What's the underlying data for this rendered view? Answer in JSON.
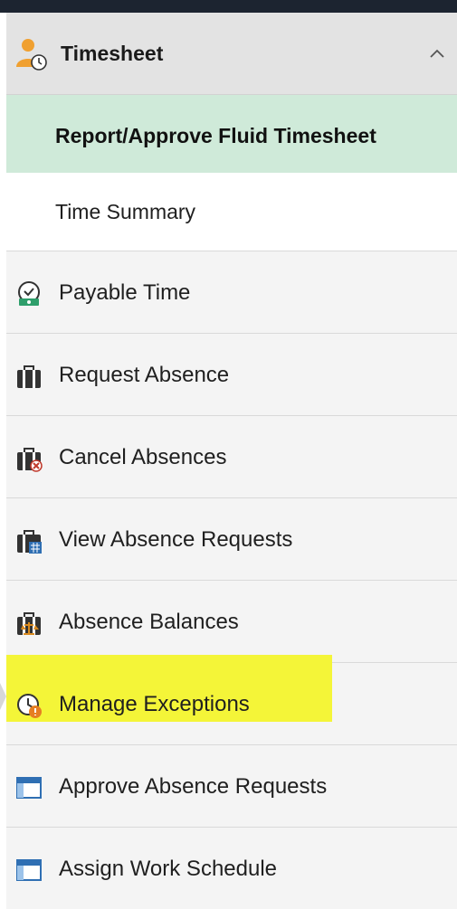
{
  "menu": {
    "header": {
      "title": "Timesheet",
      "icon": "user-clock-icon",
      "chevron": "chevron-up-icon"
    },
    "subitems": [
      {
        "label": "Report/Approve Fluid Timesheet",
        "active": true
      },
      {
        "label": "Time Summary",
        "active": false
      }
    ],
    "items": [
      {
        "label": "Payable Time",
        "icon": "payable-time-icon"
      },
      {
        "label": "Request Absence",
        "icon": "briefcase-icon"
      },
      {
        "label": "Cancel Absences",
        "icon": "briefcase-cancel-icon"
      },
      {
        "label": "View Absence Requests",
        "icon": "briefcase-calendar-icon"
      },
      {
        "label": "Absence Balances",
        "icon": "briefcase-balance-icon"
      },
      {
        "label": "Manage Exceptions",
        "icon": "clock-warning-icon",
        "highlighted": true
      },
      {
        "label": "Approve Absence Requests",
        "icon": "window-icon"
      },
      {
        "label": "Assign Work Schedule",
        "icon": "window-icon"
      }
    ]
  },
  "colors": {
    "active_bg": "#cfead9",
    "highlight": "#f4f538",
    "panel_bg": "#f4f4f4",
    "header_bg": "#e3e3e3"
  }
}
